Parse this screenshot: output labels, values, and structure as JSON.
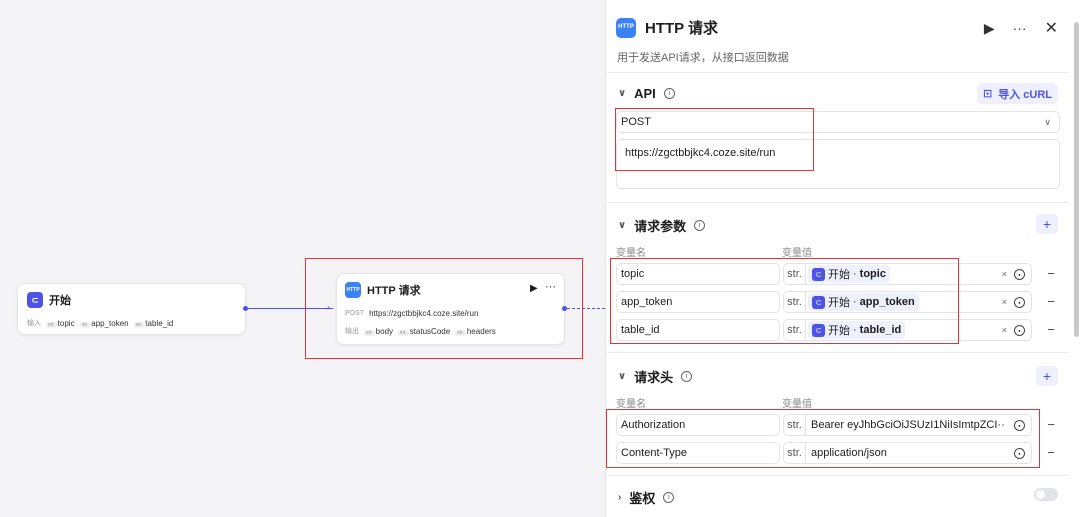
{
  "start_node": {
    "title": "开始",
    "input_label": "输入",
    "inputs": [
      {
        "type": "str.",
        "name": "topic"
      },
      {
        "type": "str.",
        "name": "app_token"
      },
      {
        "type": "str.",
        "name": "table_id"
      }
    ]
  },
  "http_node": {
    "title": "HTTP 请求",
    "icon_text": "HTTP",
    "method": "POST",
    "url": "https://zgctbbjkc4.coze.site/run",
    "output_label": "输出",
    "outputs": [
      {
        "type": "str.",
        "name": "body"
      },
      {
        "type": "int.",
        "name": "statusCode"
      },
      {
        "type": "str.",
        "name": "headers"
      }
    ]
  },
  "panel": {
    "icon_text": "HTTP",
    "title": "HTTP 请求",
    "description": "用于发送API请求，从接口返回数据",
    "api": {
      "title": "API",
      "import_label": "导入 cURL",
      "method": "POST",
      "url": "https://zgctbbjkc4.coze.site/run"
    },
    "params": {
      "title": "请求参数",
      "name_col": "变量名",
      "value_col": "变量值",
      "rows": [
        {
          "name": "topic",
          "type": "str.",
          "source": "开始",
          "sep": "·",
          "var": "topic"
        },
        {
          "name": "app_token",
          "type": "str.",
          "source": "开始",
          "sep": "·",
          "var": "app_token"
        },
        {
          "name": "table_id",
          "type": "str.",
          "source": "开始",
          "sep": "·",
          "var": "table_id"
        }
      ]
    },
    "headers": {
      "title": "请求头",
      "name_col": "变量名",
      "value_col": "变量值",
      "rows": [
        {
          "name": "Authorization",
          "type": "str.",
          "value": "Bearer eyJhbGciOiJSUzI1NiIsImtpZCI···"
        },
        {
          "name": "Content-Type",
          "type": "str.",
          "value": "application/json"
        }
      ]
    },
    "auth": {
      "title": "鉴权",
      "enabled": false
    }
  },
  "colors": {
    "accent": "#4d53e8",
    "highlight": "#e5333b",
    "http_icon": "#3b82f6"
  }
}
